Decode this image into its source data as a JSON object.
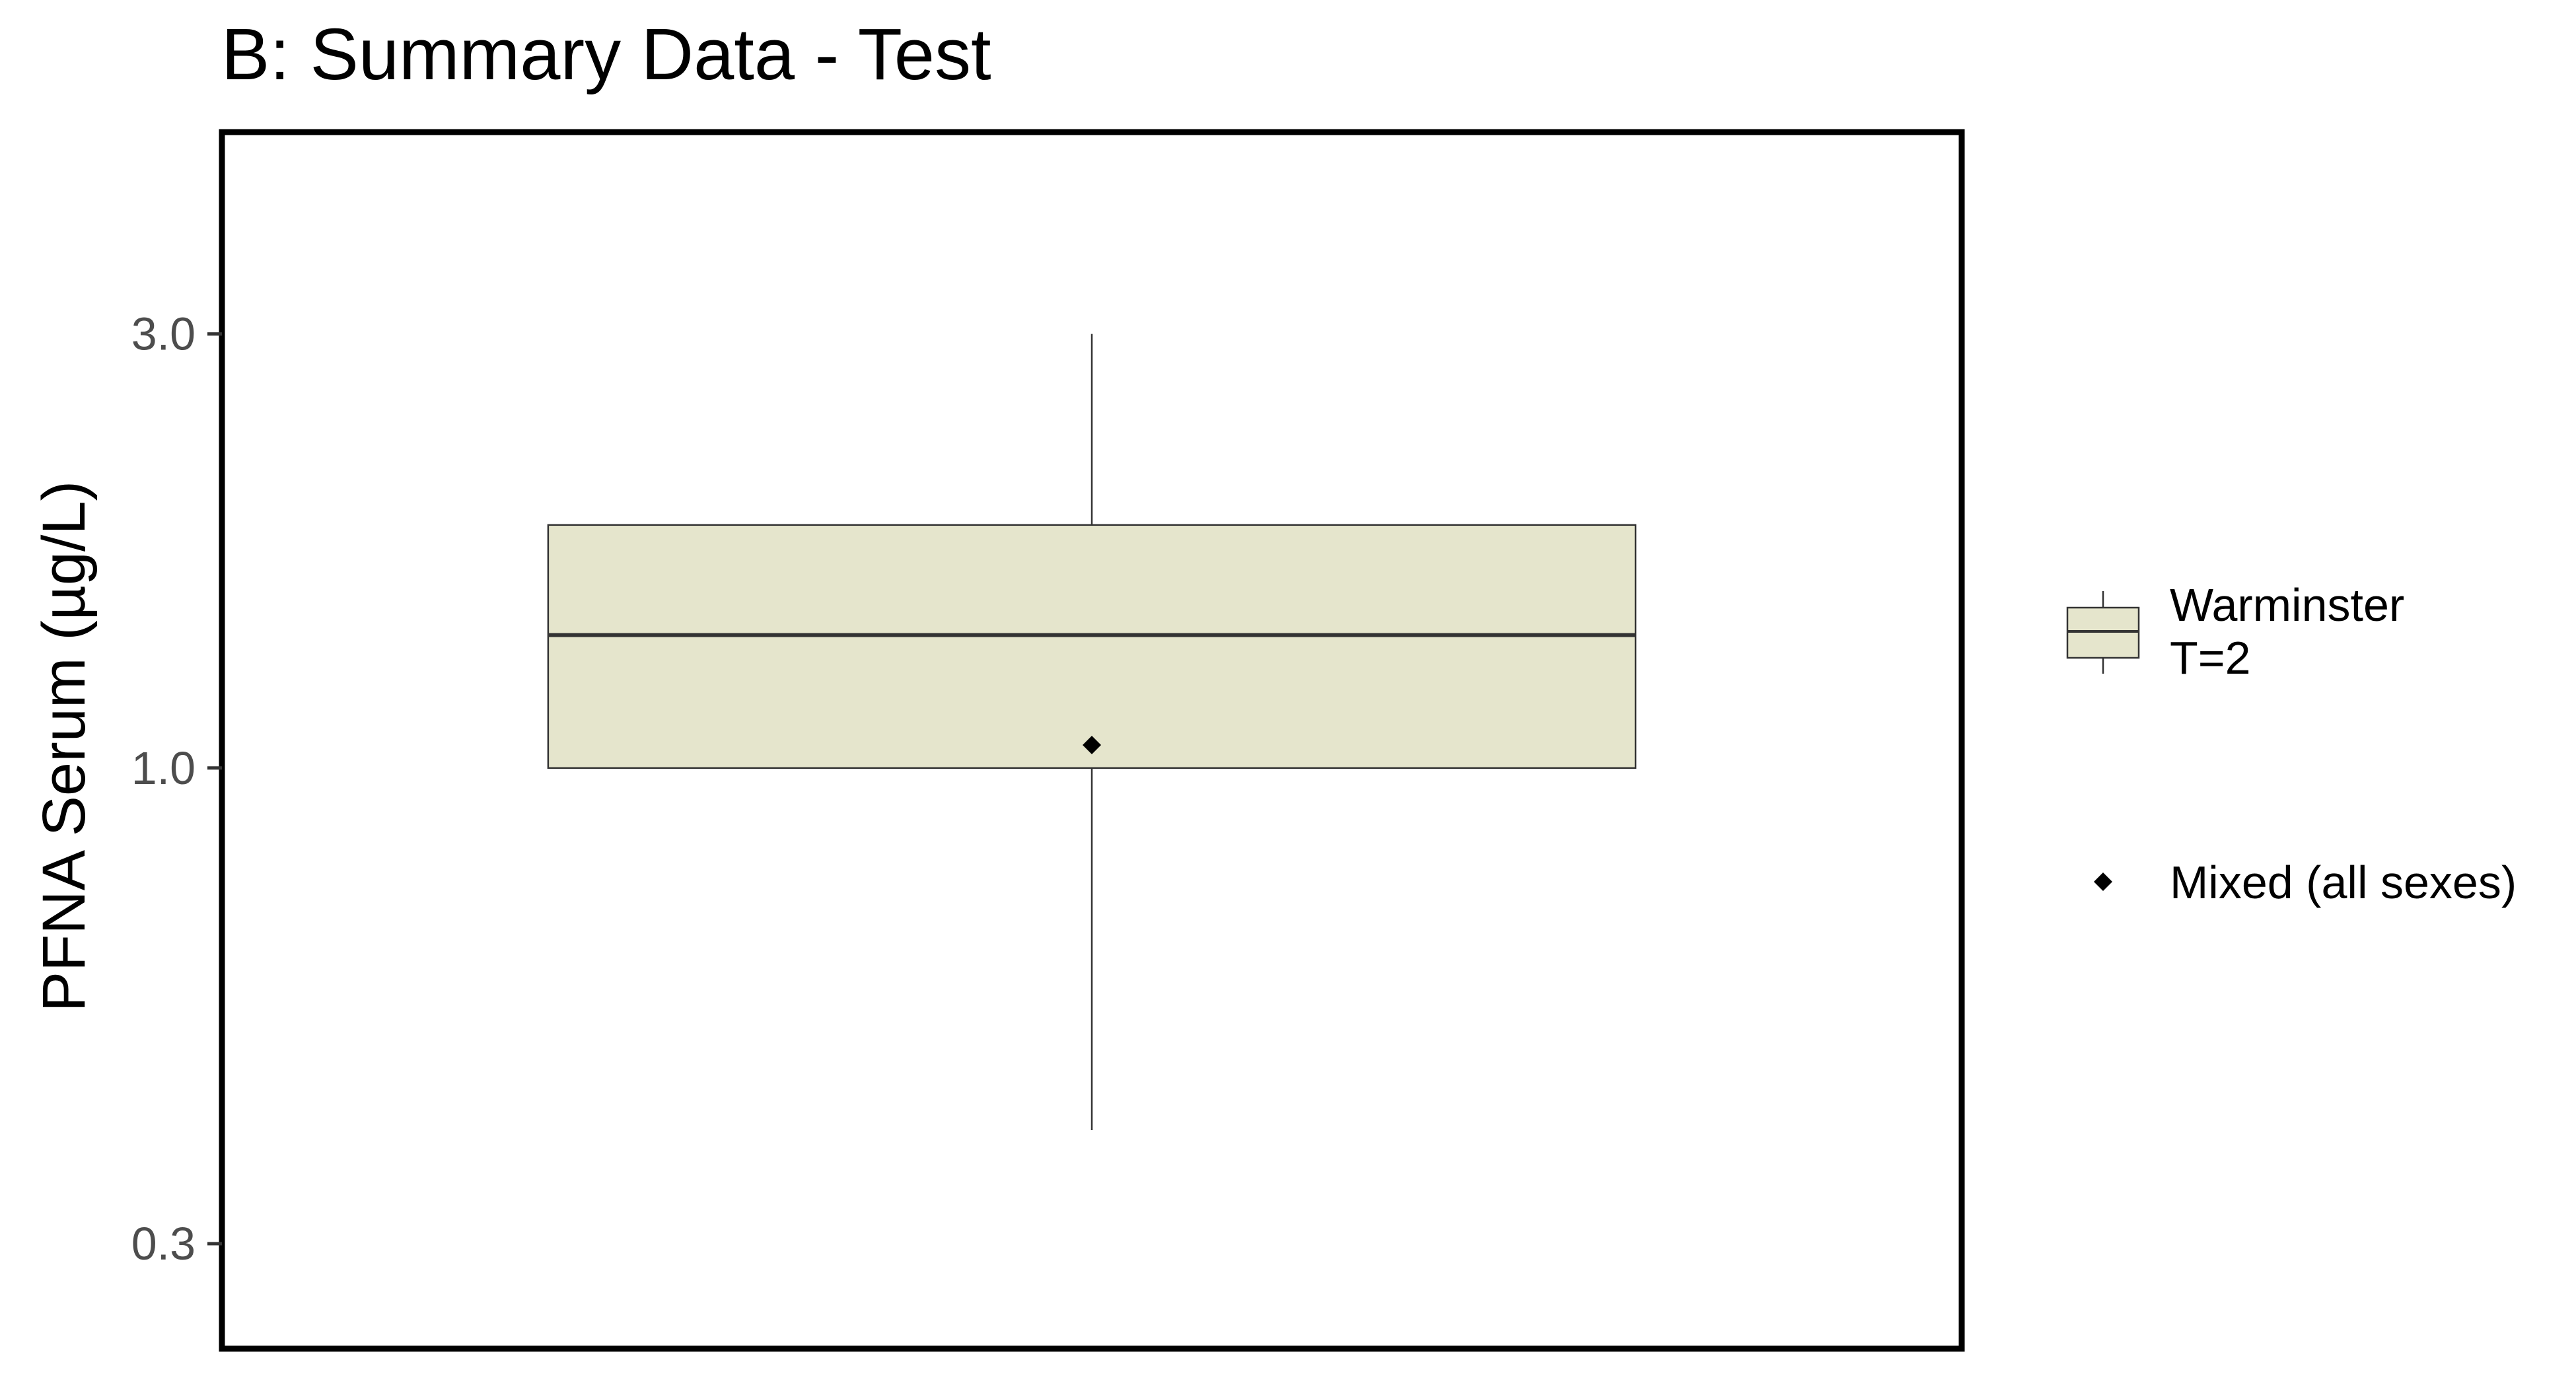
{
  "chart_data": {
    "type": "box",
    "title": "B: Summary Data - Test",
    "ylabel": "PFNA Serum (µg/L)",
    "xlabel": "",
    "y_scale": "log10",
    "ylim": [
      0.23,
      5.0
    ],
    "y_ticks": [
      {
        "value": 0.3,
        "label": "0.3"
      },
      {
        "value": 1.0,
        "label": "1.0"
      },
      {
        "value": 3.0,
        "label": "3.0"
      }
    ],
    "grid": false,
    "legend_position": "right",
    "series": [
      {
        "name": "Warminster\nT=2",
        "group": "Warminster",
        "label_lines": [
          "Warminster",
          "T=2"
        ],
        "whisker_low": 0.4,
        "q1": 1.0,
        "median": 1.4,
        "q3": 1.85,
        "whisker_high": 3.0,
        "mean": 1.06,
        "mean_label": "Mixed (all sexes)",
        "fill": "#e5e5cc",
        "stroke": "#333333"
      }
    ],
    "colors": {
      "box_fill": "#e5e5cc",
      "box_stroke": "#333333",
      "median": "#333333",
      "mean_marker": "#000000",
      "panel_border": "#000000",
      "tick_label": "#4d4d4d",
      "text": "#000000"
    }
  }
}
